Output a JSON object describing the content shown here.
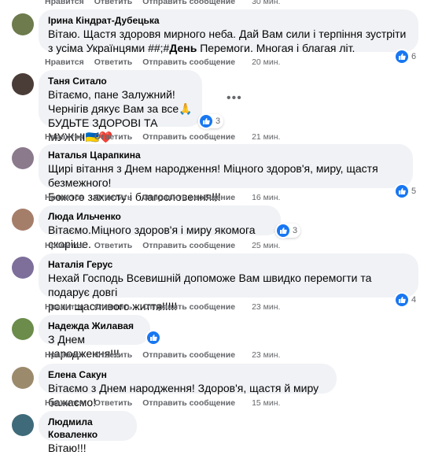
{
  "actions": {
    "like": "Нравится",
    "reply": "Ответить",
    "translate": "Отправить сообщение"
  },
  "top": {
    "like": "Нравится",
    "reply": "Ответить",
    "translate": "Отправить сообщение",
    "time": "30 мин."
  },
  "comments": [
    {
      "name": "Ірина Кіндрат-Дубецька",
      "text": "Вітаю. Щастя здоровя мирного неба. Дай Вам сили і терпіння зустріти з усіма Українцями ##;#",
      "text_bold": "День",
      "text_end": " Перемоги. Многая і благая літ.",
      "time": "20 мин.",
      "reactions": "6",
      "avatar_color": "#6d7b4d"
    },
    {
      "name": "Таня Ситало",
      "text": "Вітаємо, пане Залужний!\nЧернігів дякує Вам за все🙏\nБУДЬТЕ ЗДОРОВІ ТА МУЖНІ🇺🇦❤️",
      "time": "21 мин.",
      "reactions": "3",
      "avatar_color": "#4a3d38"
    },
    {
      "name": "Наталья Царапкина",
      "text": "Щирі вітання з Днем народження! Міцного здоров'я, миру, щастя безмежного!\nБожого захисту і благословення!!!",
      "time": "16 мин.",
      "reactions": "5",
      "avatar_color": "#8a7a8c"
    },
    {
      "name": "Люда Ильченко",
      "text": "Вітаємо.Міцного здоров'я і миру якомога скоріше.",
      "time": "25 мин.",
      "reactions": "3",
      "avatar_color": "#a57e6a"
    },
    {
      "name": "Наталія Герус",
      "text": "Нехай Господь Всевишній допоможе Вам швидко перемогти та подарує довгі\nроки щасливого життя!!!!!",
      "time": "23 мин.",
      "reactions": "4",
      "avatar_color": "#7d6f9a"
    },
    {
      "name": "Надежда Жилавая",
      "text": "З Днем народження!!!",
      "time": "23 мин.",
      "reactions": "",
      "avatar_color": "#6b8c4a"
    },
    {
      "name": "Елена Сакун",
      "text": "Вітаємо з Днем народження! Здоров'я, щастя й миру бажаємо!",
      "time": "15 мин.",
      "reactions": "",
      "avatar_color": "#9c8a6d"
    },
    {
      "name": "Людмила Коваленко",
      "text": "Вітаю!!!",
      "time": "",
      "reactions": "",
      "avatar_color": "#3f6a7a"
    }
  ]
}
